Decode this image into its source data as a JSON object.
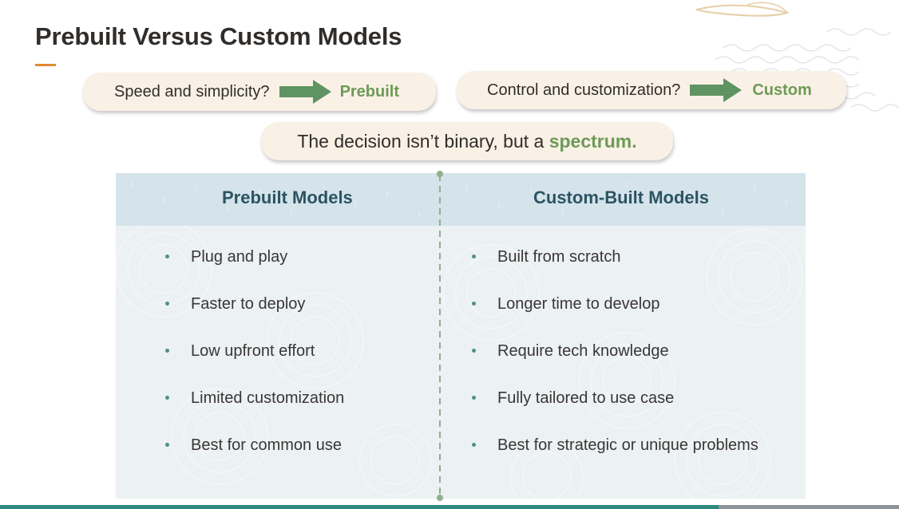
{
  "slide": {
    "title": "Prebuilt Versus Custom Models"
  },
  "questions": [
    {
      "question": "Speed and simplicity?",
      "answer": "Prebuilt"
    },
    {
      "question": "Control and customization?",
      "answer": "Custom"
    }
  ],
  "spectrum": {
    "text": "The decision isn’t binary, but a ",
    "highlight": "spectrum."
  },
  "comparison": {
    "left": {
      "heading": "Prebuilt Models",
      "items": [
        "Plug and play",
        "Faster to deploy",
        "Low upfront effort",
        "Limited customization",
        "Best for common use"
      ]
    },
    "right": {
      "heading": "Custom-Built Models",
      "items": [
        "Built from scratch",
        "Longer time to develop",
        "Require tech knowledge",
        "Fully tailored to use case",
        "Best for strategic or unique problems"
      ]
    }
  },
  "colors": {
    "accent_orange": "#e08a32",
    "answer_green": "#6e9a57",
    "arrow_green": "#5f9361",
    "heading_teal": "#2b5461",
    "pill_background": "#faf1e6",
    "table_header": "#d5e3ea",
    "table_body": "#ecf1f4",
    "bottom_bar": "#2c8a80"
  },
  "icons": {
    "arrow": "arrow-right-icon",
    "bullet": "bullet-dot-icon"
  }
}
